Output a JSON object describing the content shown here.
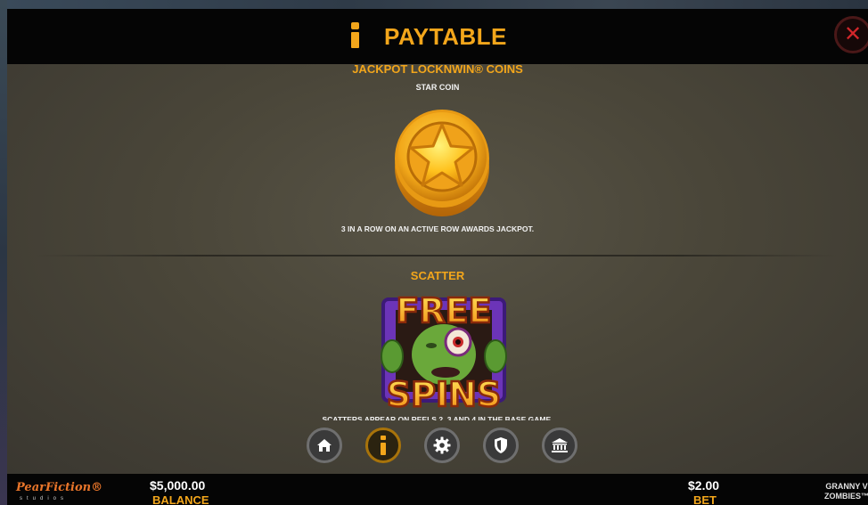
{
  "header": {
    "title": "PAYTABLE",
    "info_icon": "info-icon",
    "close_icon": "close-icon"
  },
  "sections": {
    "jackpot": {
      "title": "JACKPOT LOCKNWIN® COINS",
      "subtitle": "STAR COIN",
      "symbol": "star-coin-icon",
      "description": "3 IN A ROW ON AN ACTIVE ROW AWARDS JACKPOT."
    },
    "scatter": {
      "title": "SCATTER",
      "symbol_text_top": "FREE",
      "symbol_text_bottom": "SPINS",
      "description": "SCATTERS APPEAR ON REELS 2, 3 AND 4 IN THE BASE GAME."
    }
  },
  "nav": [
    {
      "icon": "home-icon",
      "active": false
    },
    {
      "icon": "info-icon",
      "active": true
    },
    {
      "icon": "gear-icon",
      "active": false
    },
    {
      "icon": "shield-icon",
      "active": false
    },
    {
      "icon": "bank-icon",
      "active": false
    }
  ],
  "footer": {
    "logo_text": "PearFiction®",
    "logo_sub": "studios",
    "balance_value": "$5,000.00",
    "balance_label": "BALANCE",
    "bet_value": "$2.00",
    "bet_label": "BET",
    "game_line1": "GRANNY V",
    "game_line2": "ZOMBIES™"
  },
  "colors": {
    "accent": "#f3a61b",
    "header_bg": "#050505",
    "panel_bg": "#4a4639",
    "close_red": "#d2262a"
  }
}
